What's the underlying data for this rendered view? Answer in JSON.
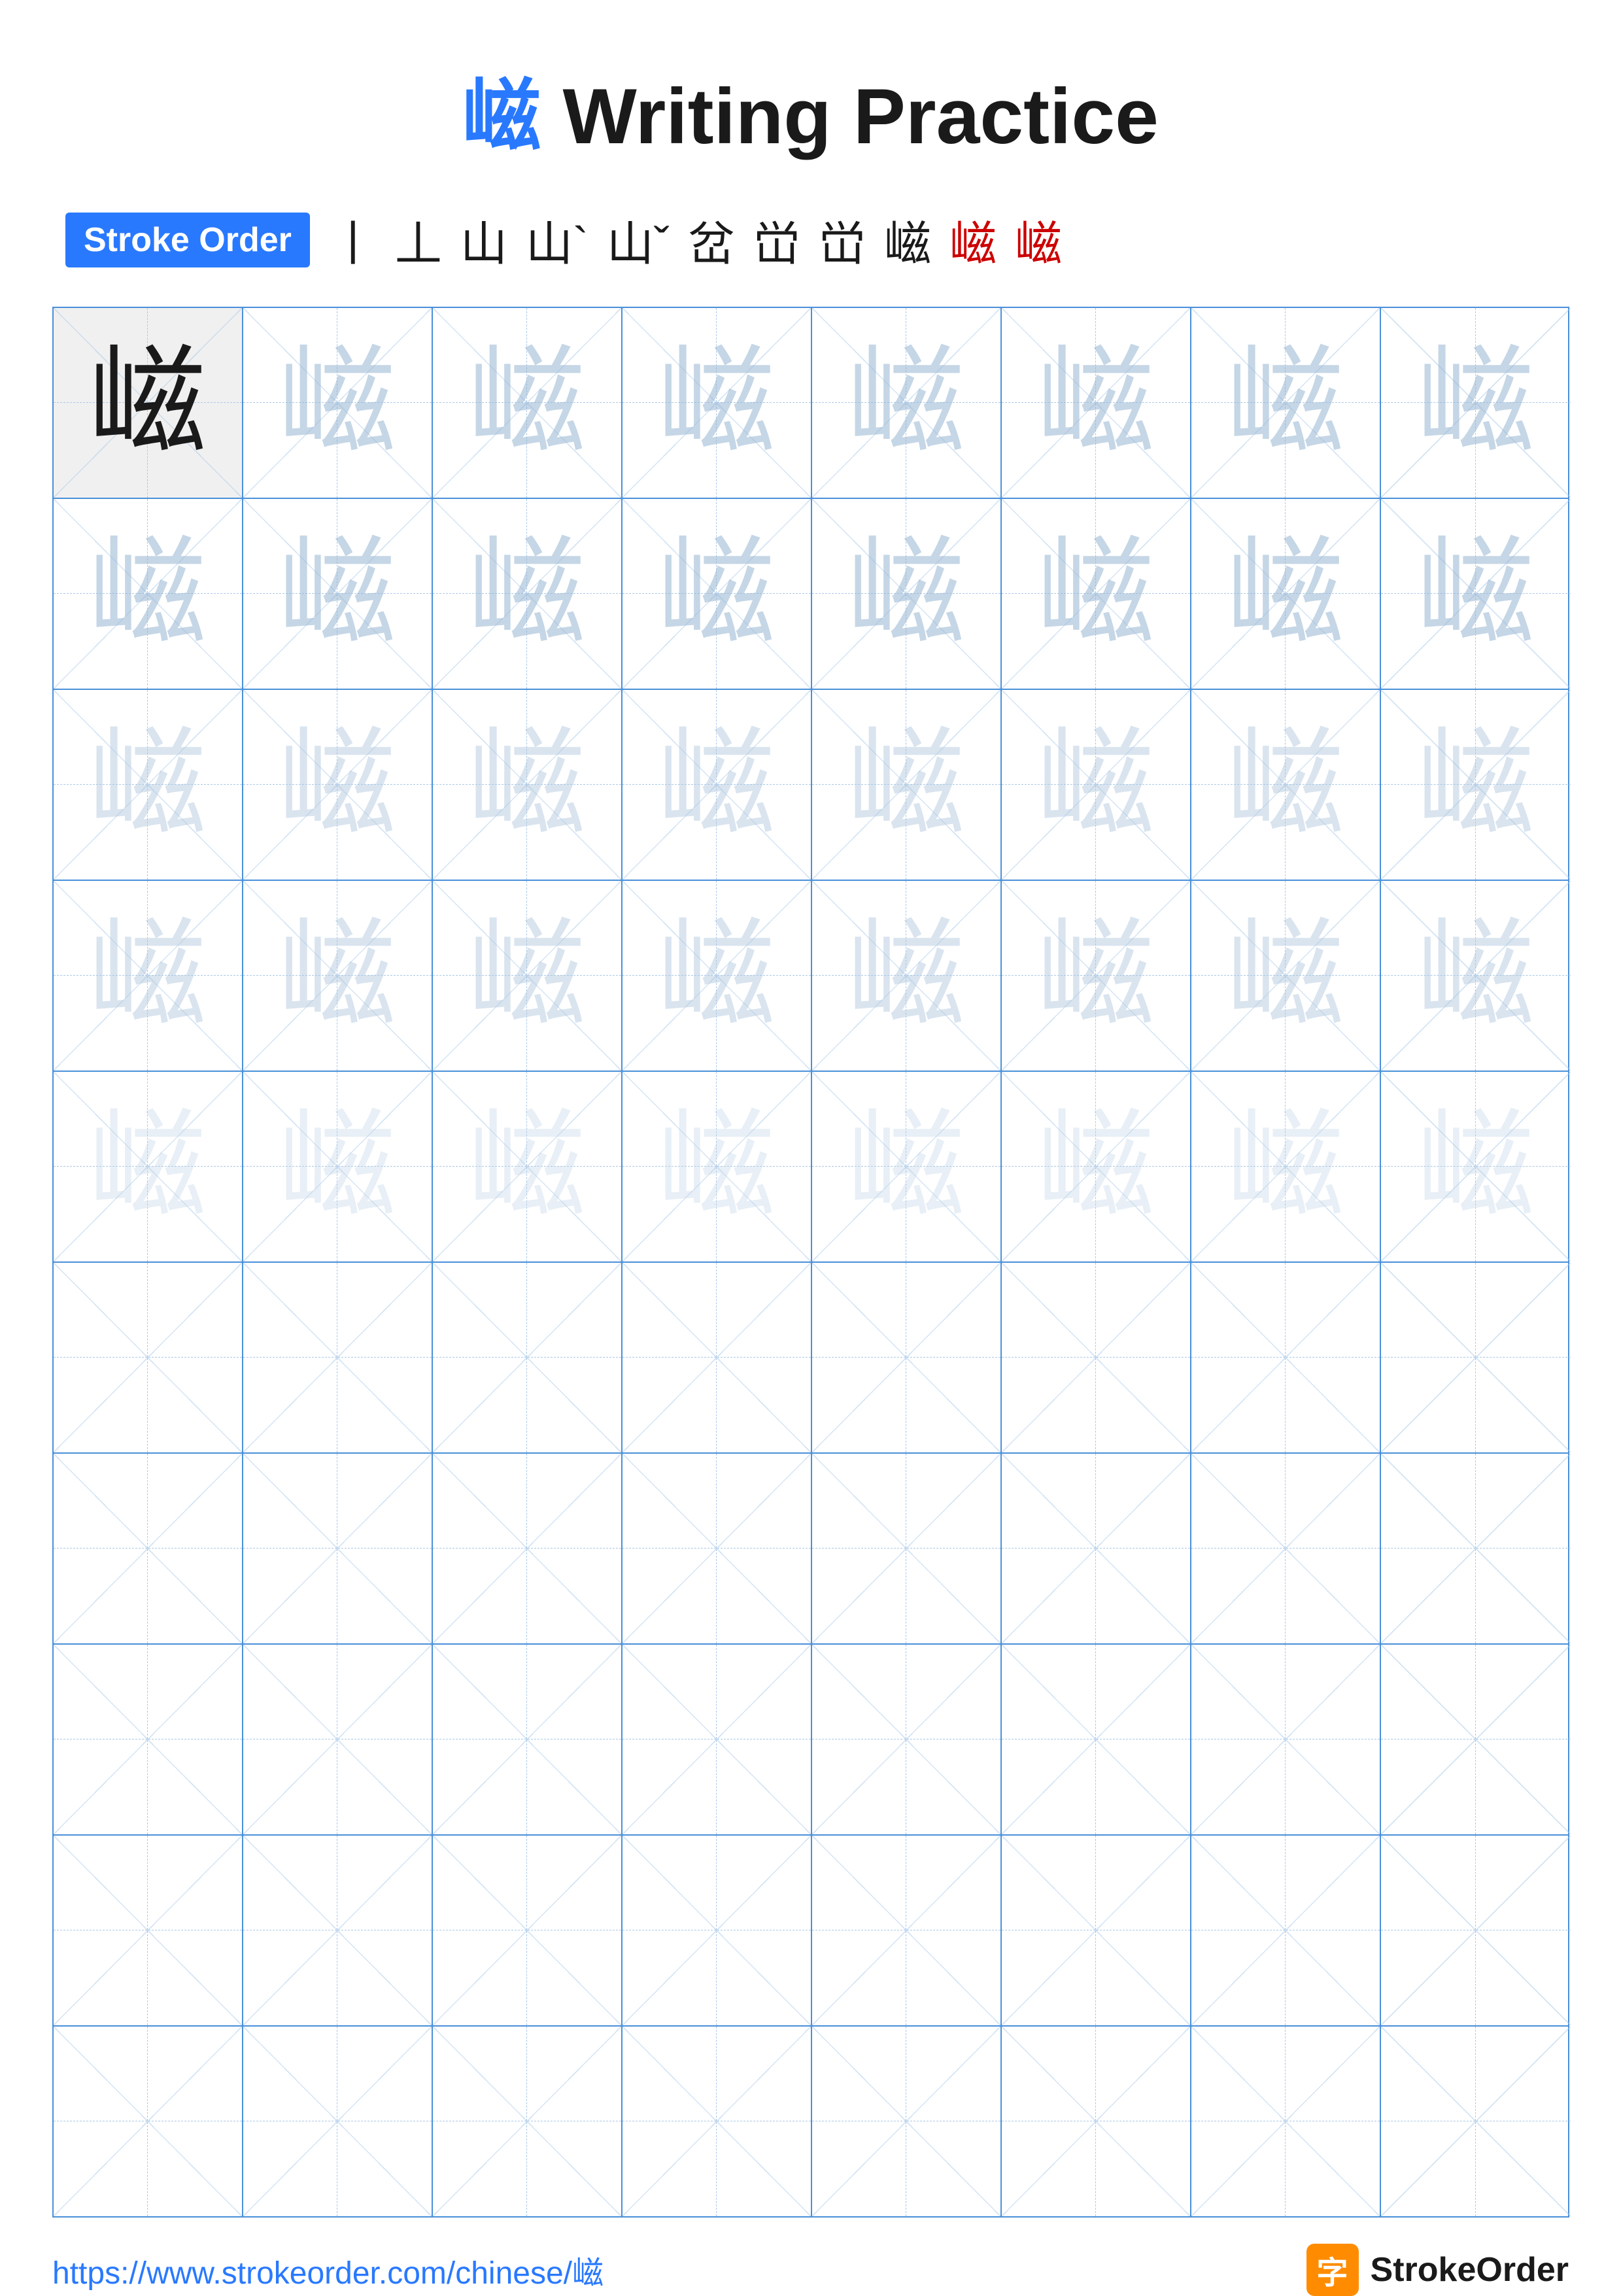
{
  "title": {
    "char": "嵫",
    "text": " Writing Practice"
  },
  "stroke_order": {
    "label": "Stroke Order",
    "chars": [
      "丨",
      "丄",
      "山",
      "山`",
      "山ˇ",
      "山乛",
      "嵫乛",
      "嵫乛",
      "嵫乛",
      "嵫乛",
      "嵫"
    ]
  },
  "grid": {
    "rows": 10,
    "cols": 8,
    "practice_char": "嵫"
  },
  "footer": {
    "url": "https://www.strokeorder.com/chinese/嵫",
    "brand": "StrokeOrder"
  }
}
